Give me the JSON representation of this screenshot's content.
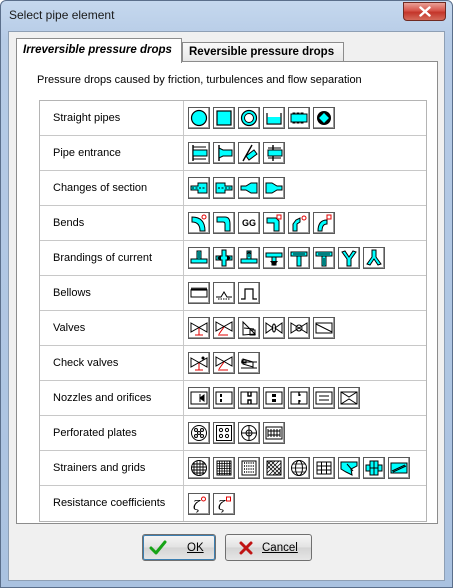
{
  "window": {
    "title": "Select pipe element",
    "close_label": "×"
  },
  "tabs": [
    {
      "label": "Irreversible pressure drops",
      "active": true
    },
    {
      "label": "Reversible pressure drops",
      "active": false
    }
  ],
  "panel": {
    "heading": "Pressure drops caused by friction, turbulences and flow separation"
  },
  "categories": [
    {
      "label": "Straight pipes",
      "icons": [
        "circle-pipe-icon",
        "square-pipe-icon",
        "annulus-pipe-icon",
        "open-channel-icon",
        "corrugated-pipe-icon",
        "gear-section-icon"
      ]
    },
    {
      "label": "Pipe entrance",
      "icons": [
        "flush-entrance-icon",
        "chamfered-entrance-icon",
        "angled-entrance-icon",
        "protruding-entrance-icon"
      ]
    },
    {
      "label": "Changes of section",
      "icons": [
        "sudden-expansion-icon",
        "sudden-contraction-icon",
        "gradual-expansion-icon",
        "gradual-contraction-icon"
      ]
    },
    {
      "label": "Bends",
      "icons": [
        "bend-radius-icon",
        "bend-elbow-icon",
        "double-bend-text-icon",
        "mitre-bend-icon",
        "segmented-bend-icon",
        "arc-bend-icon"
      ]
    },
    {
      "label": "Brandings of current",
      "icons": [
        "tee-merge-icon",
        "cross-junction-icon",
        "tee-split-icon",
        "tee-down-icon",
        "tee-through-icon",
        "tee-combined-icon",
        "y-branch-icon",
        "y-merge-icon"
      ]
    },
    {
      "label": "Bellows",
      "icons": [
        "bellows-icon",
        "compensator-icon",
        "u-loop-icon"
      ]
    },
    {
      "label": "Valves",
      "icons": [
        "gate-valve-icon",
        "globe-valve-icon",
        "angle-valve-icon",
        "butterfly-valve-icon",
        "ball-valve-icon",
        "slide-valve-icon"
      ]
    },
    {
      "label": "Check valves",
      "icons": [
        "swing-check-icon",
        "lift-check-icon",
        "flap-check-icon"
      ]
    },
    {
      "label": "Nozzles and orifices",
      "icons": [
        "nozzle-icon",
        "orifice-icon",
        "long-orifice-icon",
        "double-orifice-icon",
        "venturi-icon",
        "flat-orifice-icon",
        "diamond-orifice-icon"
      ]
    },
    {
      "label": "Perforated plates",
      "icons": [
        "perforated-plate-icon",
        "perforated-grid-icon",
        "perforated-ring-icon",
        "perforated-strip-icon"
      ]
    },
    {
      "label": "Strainers and grids",
      "icons": [
        "round-mesh-icon",
        "square-mesh-icon",
        "dotted-mesh-icon",
        "hatched-mesh-icon",
        "sphere-mesh-icon",
        "bar-grid-icon",
        "inclined-strainer-icon",
        "basket-strainer-icon",
        "wedge-screen-icon"
      ]
    },
    {
      "label": "Resistance coefficients",
      "icons": [
        "zeta-circle-icon",
        "zeta-square-icon"
      ]
    }
  ],
  "bend_text": "GG",
  "buttons": {
    "ok_label": "OK",
    "cancel_label": "Cancel"
  },
  "colors": {
    "accent_cyan": "#00ffff",
    "accent_red": "#e00000",
    "ok_check": "#16a316",
    "cancel_x": "#c01414"
  }
}
